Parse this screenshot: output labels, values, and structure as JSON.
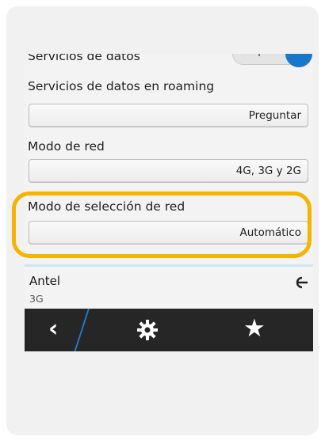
{
  "settings": {
    "data_services": {
      "label": "Servicios de datos",
      "toggle_text": "I"
    },
    "roaming": {
      "label": "Servicios de datos en roaming",
      "value": "Preguntar"
    },
    "network_mode": {
      "label": "Modo de red",
      "value": "4G, 3G y 2G"
    },
    "network_selection": {
      "label": "Modo de selección de red",
      "value": "Automático"
    }
  },
  "network": {
    "name": "Antel",
    "type": "3G",
    "icon": "signal-connector-icon"
  },
  "actionbar": {
    "back_icon": "‹",
    "settings_icon": "✸",
    "favorite_icon": "★"
  },
  "colors": {
    "highlight": "#f5b400",
    "accent": "#1877c9",
    "actionbar": "#262626"
  }
}
